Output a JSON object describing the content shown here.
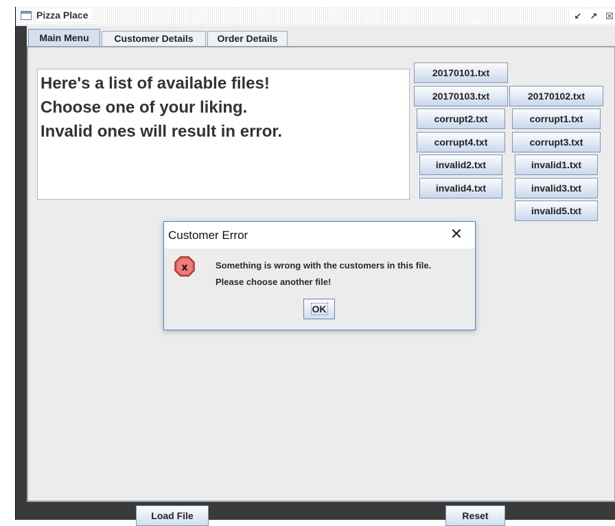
{
  "window": {
    "title": "Pizza Place"
  },
  "tabs": [
    {
      "label": "Main Menu"
    },
    {
      "label": "Customer Details"
    },
    {
      "label": "Order Details"
    }
  ],
  "main": {
    "file_list_text": [
      "Here's a list of available files!",
      "Choose one of your liking.",
      "Invalid ones will result in error."
    ],
    "files": [
      "20170101.txt",
      "20170103.txt",
      "20170102.txt",
      "corrupt2.txt",
      "corrupt1.txt",
      "corrupt4.txt",
      "corrupt3.txt",
      "invalid2.txt",
      "invalid1.txt",
      "invalid4.txt",
      "invalid3.txt",
      "invalid5.txt"
    ]
  },
  "bottom": {
    "load_label": "Load File",
    "reset_label": "Reset"
  },
  "dialog": {
    "title": "Customer Error",
    "message_line1": "Something is wrong with the customers in this file.",
    "message_line2": "Please choose another file!",
    "ok_label": "OK",
    "icon": "error-icon",
    "icon_color": "#e05a5a"
  }
}
